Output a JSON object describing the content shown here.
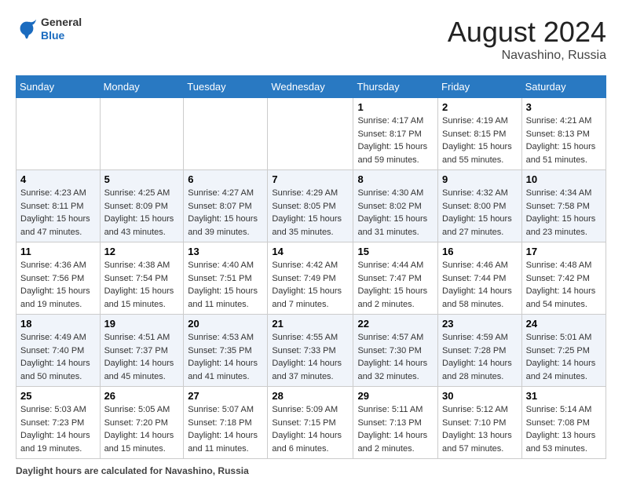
{
  "header": {
    "logo_general": "General",
    "logo_blue": "Blue",
    "month_year": "August 2024",
    "location": "Navashino, Russia"
  },
  "days_of_week": [
    "Sunday",
    "Monday",
    "Tuesday",
    "Wednesday",
    "Thursday",
    "Friday",
    "Saturday"
  ],
  "weeks": [
    [
      {
        "day": "",
        "sunrise": "",
        "sunset": "",
        "daylight": ""
      },
      {
        "day": "",
        "sunrise": "",
        "sunset": "",
        "daylight": ""
      },
      {
        "day": "",
        "sunrise": "",
        "sunset": "",
        "daylight": ""
      },
      {
        "day": "",
        "sunrise": "",
        "sunset": "",
        "daylight": ""
      },
      {
        "day": "1",
        "sunrise": "4:17 AM",
        "sunset": "8:17 PM",
        "daylight": "15 hours and 59 minutes."
      },
      {
        "day": "2",
        "sunrise": "4:19 AM",
        "sunset": "8:15 PM",
        "daylight": "15 hours and 55 minutes."
      },
      {
        "day": "3",
        "sunrise": "4:21 AM",
        "sunset": "8:13 PM",
        "daylight": "15 hours and 51 minutes."
      }
    ],
    [
      {
        "day": "4",
        "sunrise": "4:23 AM",
        "sunset": "8:11 PM",
        "daylight": "15 hours and 47 minutes."
      },
      {
        "day": "5",
        "sunrise": "4:25 AM",
        "sunset": "8:09 PM",
        "daylight": "15 hours and 43 minutes."
      },
      {
        "day": "6",
        "sunrise": "4:27 AM",
        "sunset": "8:07 PM",
        "daylight": "15 hours and 39 minutes."
      },
      {
        "day": "7",
        "sunrise": "4:29 AM",
        "sunset": "8:05 PM",
        "daylight": "15 hours and 35 minutes."
      },
      {
        "day": "8",
        "sunrise": "4:30 AM",
        "sunset": "8:02 PM",
        "daylight": "15 hours and 31 minutes."
      },
      {
        "day": "9",
        "sunrise": "4:32 AM",
        "sunset": "8:00 PM",
        "daylight": "15 hours and 27 minutes."
      },
      {
        "day": "10",
        "sunrise": "4:34 AM",
        "sunset": "7:58 PM",
        "daylight": "15 hours and 23 minutes."
      }
    ],
    [
      {
        "day": "11",
        "sunrise": "4:36 AM",
        "sunset": "7:56 PM",
        "daylight": "15 hours and 19 minutes."
      },
      {
        "day": "12",
        "sunrise": "4:38 AM",
        "sunset": "7:54 PM",
        "daylight": "15 hours and 15 minutes."
      },
      {
        "day": "13",
        "sunrise": "4:40 AM",
        "sunset": "7:51 PM",
        "daylight": "15 hours and 11 minutes."
      },
      {
        "day": "14",
        "sunrise": "4:42 AM",
        "sunset": "7:49 PM",
        "daylight": "15 hours and 7 minutes."
      },
      {
        "day": "15",
        "sunrise": "4:44 AM",
        "sunset": "7:47 PM",
        "daylight": "15 hours and 2 minutes."
      },
      {
        "day": "16",
        "sunrise": "4:46 AM",
        "sunset": "7:44 PM",
        "daylight": "14 hours and 58 minutes."
      },
      {
        "day": "17",
        "sunrise": "4:48 AM",
        "sunset": "7:42 PM",
        "daylight": "14 hours and 54 minutes."
      }
    ],
    [
      {
        "day": "18",
        "sunrise": "4:49 AM",
        "sunset": "7:40 PM",
        "daylight": "14 hours and 50 minutes."
      },
      {
        "day": "19",
        "sunrise": "4:51 AM",
        "sunset": "7:37 PM",
        "daylight": "14 hours and 45 minutes."
      },
      {
        "day": "20",
        "sunrise": "4:53 AM",
        "sunset": "7:35 PM",
        "daylight": "14 hours and 41 minutes."
      },
      {
        "day": "21",
        "sunrise": "4:55 AM",
        "sunset": "7:33 PM",
        "daylight": "14 hours and 37 minutes."
      },
      {
        "day": "22",
        "sunrise": "4:57 AM",
        "sunset": "7:30 PM",
        "daylight": "14 hours and 32 minutes."
      },
      {
        "day": "23",
        "sunrise": "4:59 AM",
        "sunset": "7:28 PM",
        "daylight": "14 hours and 28 minutes."
      },
      {
        "day": "24",
        "sunrise": "5:01 AM",
        "sunset": "7:25 PM",
        "daylight": "14 hours and 24 minutes."
      }
    ],
    [
      {
        "day": "25",
        "sunrise": "5:03 AM",
        "sunset": "7:23 PM",
        "daylight": "14 hours and 19 minutes."
      },
      {
        "day": "26",
        "sunrise": "5:05 AM",
        "sunset": "7:20 PM",
        "daylight": "14 hours and 15 minutes."
      },
      {
        "day": "27",
        "sunrise": "5:07 AM",
        "sunset": "7:18 PM",
        "daylight": "14 hours and 11 minutes."
      },
      {
        "day": "28",
        "sunrise": "5:09 AM",
        "sunset": "7:15 PM",
        "daylight": "14 hours and 6 minutes."
      },
      {
        "day": "29",
        "sunrise": "5:11 AM",
        "sunset": "7:13 PM",
        "daylight": "14 hours and 2 minutes."
      },
      {
        "day": "30",
        "sunrise": "5:12 AM",
        "sunset": "7:10 PM",
        "daylight": "13 hours and 57 minutes."
      },
      {
        "day": "31",
        "sunrise": "5:14 AM",
        "sunset": "7:08 PM",
        "daylight": "13 hours and 53 minutes."
      }
    ]
  ],
  "footer": {
    "label": "Daylight hours",
    "description": "are calculated for Navashino, Russia"
  },
  "labels": {
    "sunrise_prefix": "Sunrise: ",
    "sunset_prefix": "Sunset: ",
    "daylight_prefix": "Daylight: "
  }
}
